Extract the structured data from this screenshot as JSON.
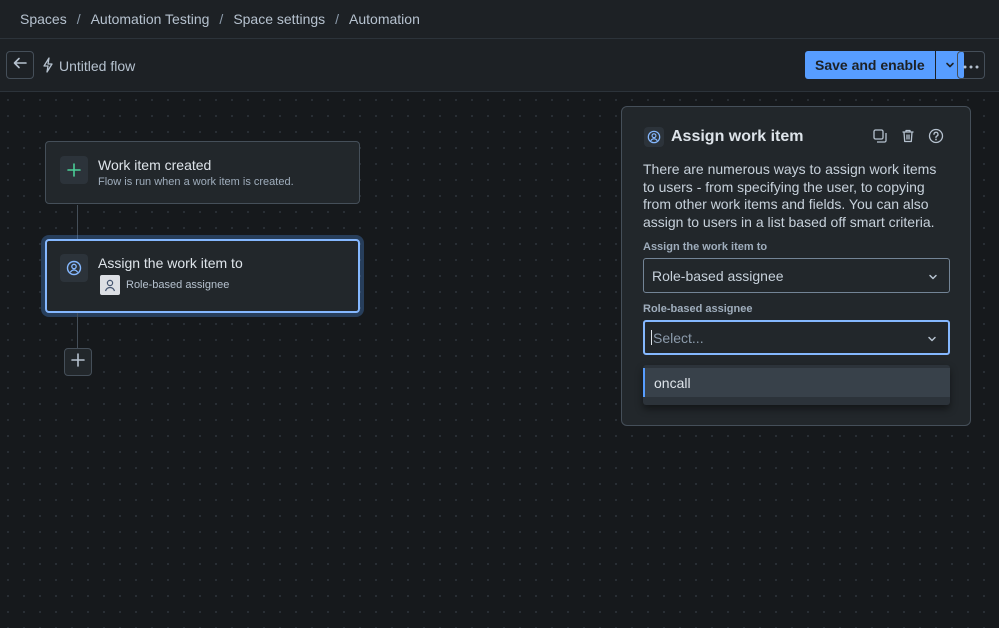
{
  "breadcrumb": {
    "items": [
      "Spaces",
      "Automation Testing",
      "Space settings",
      "Automation"
    ],
    "separator": "/"
  },
  "toolbar": {
    "back_icon": "arrow-left-icon",
    "flow_icon": "lightning-icon",
    "flow_title": "Untitled flow",
    "save_label": "Save and enable",
    "more_icon": "more-horizontal-icon"
  },
  "canvas": {
    "trigger": {
      "icon": "plus-icon",
      "title": "Work item created",
      "subtitle": "Flow is run when a work item is created."
    },
    "action": {
      "icon": "assign-person-icon",
      "title": "Assign the work item to",
      "chip_label": "Role-based assignee"
    },
    "add_step_icon": "plus-icon"
  },
  "panel": {
    "title": "Assign work item",
    "description": "There are numerous ways to assign work items to users - from specifying the user, to copying from other work items and fields. You can also assign to users in a list based off smart criteria.",
    "assign_label": "Assign the work item to",
    "assign_value": "Role-based assignee",
    "role_label": "Role-based assignee",
    "role_placeholder": "Select...",
    "options": [
      "oncall"
    ]
  },
  "colors": {
    "accent": "#579dff",
    "background": "#1d2125",
    "canvas": "#16191c",
    "panel": "#22272b"
  }
}
